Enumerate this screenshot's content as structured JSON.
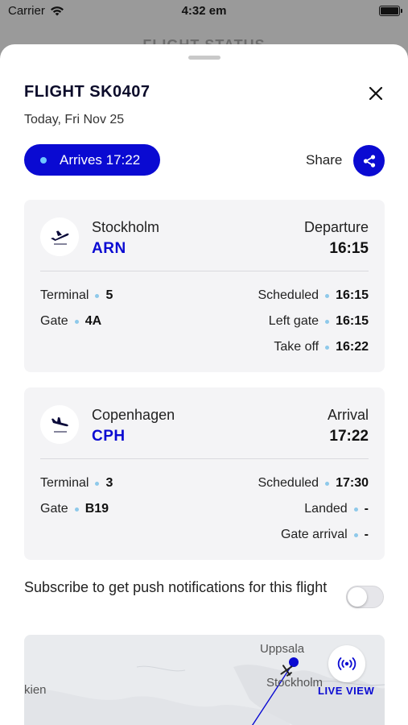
{
  "status_bar": {
    "carrier": "Carrier",
    "time": "4:32 em",
    "wifi_icon": "wifi-icon",
    "battery_icon": "battery-icon"
  },
  "background_title": "FLIGHT STATUS",
  "flight": {
    "title": "FLIGHT SK0407",
    "date": "Today, Fri Nov 25",
    "status_pill": "Arrives 17:22",
    "share_label": "Share"
  },
  "departure": {
    "city": "Stockholm",
    "code": "ARN",
    "kind": "Departure",
    "time": "16:15",
    "left_rows": [
      {
        "label": "Terminal",
        "value": "5"
      },
      {
        "label": "Gate",
        "value": "4A"
      }
    ],
    "right_rows": [
      {
        "label": "Scheduled",
        "value": "16:15"
      },
      {
        "label": "Left gate",
        "value": "16:15"
      },
      {
        "label": "Take off",
        "value": "16:22"
      }
    ]
  },
  "arrival": {
    "city": "Copenhagen",
    "code": "CPH",
    "kind": "Arrival",
    "time": "17:22",
    "left_rows": [
      {
        "label": "Terminal",
        "value": "3"
      },
      {
        "label": "Gate",
        "value": "B19"
      }
    ],
    "right_rows": [
      {
        "label": "Scheduled",
        "value": "17:30"
      },
      {
        "label": "Landed",
        "value": "-"
      },
      {
        "label": "Gate arrival",
        "value": "-"
      }
    ]
  },
  "subscribe": {
    "text": "Subscribe to get push notifications for this flight",
    "enabled": false
  },
  "map": {
    "labels": {
      "uppsala": "Uppsala",
      "stockholm": "Stockholm",
      "edge_city": "kien"
    },
    "live_view_label": "LIVE VIEW"
  },
  "colors": {
    "accent": "#0a0ad2",
    "dot": "#8ec9ea"
  }
}
